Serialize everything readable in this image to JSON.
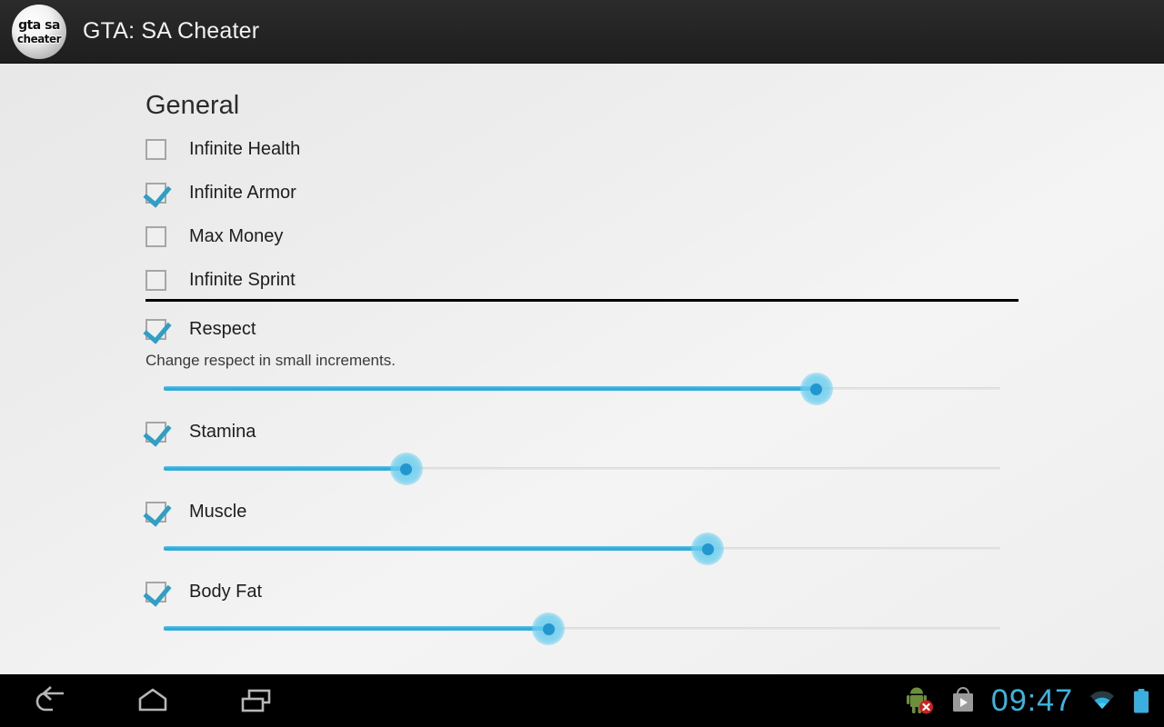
{
  "app": {
    "title": "GTA: SA Cheater",
    "logo": {
      "line1": "gta sa",
      "line2": "cheater",
      "icon": "app-logo-icon"
    }
  },
  "content": {
    "section_title": "General",
    "checkboxes": [
      {
        "label": "Infinite Health",
        "checked": false
      },
      {
        "label": "Infinite Armor",
        "checked": true
      },
      {
        "label": "Max Money",
        "checked": false
      },
      {
        "label": "Infinite Sprint",
        "checked": false
      }
    ],
    "sliders": [
      {
        "label": "Respect",
        "checked": true,
        "subtitle": "Change respect in small increments.",
        "value": 78
      },
      {
        "label": "Stamina",
        "checked": true,
        "subtitle": "",
        "value": 29
      },
      {
        "label": "Muscle",
        "checked": true,
        "subtitle": "",
        "value": 65
      },
      {
        "label": "Body Fat",
        "checked": true,
        "subtitle": "",
        "value": 46
      }
    ]
  },
  "navbar": {
    "back_label": "Back",
    "home_label": "Home",
    "recents_label": "Recent apps",
    "status": {
      "android_warning_icon": "android-robot-error-icon",
      "play_store_icon": "play-store-icon",
      "clock": "09:47",
      "wifi_icon": "wifi-icon",
      "battery_icon": "battery-full-icon"
    }
  },
  "colors": {
    "accent": "#33aedc",
    "thumb_core": "#2196cf",
    "clock": "#39b6e0",
    "action_bar": "#242424"
  }
}
